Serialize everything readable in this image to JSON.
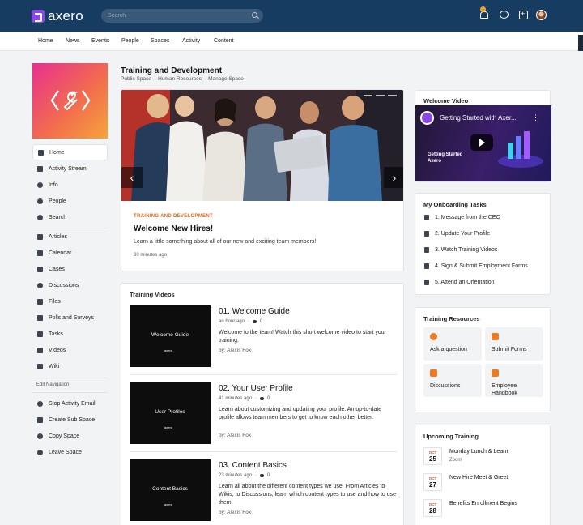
{
  "brand": {
    "name": "axero"
  },
  "search": {
    "placeholder": "Search"
  },
  "notifications": {
    "count": "1"
  },
  "nav": [
    "Home",
    "News",
    "Events",
    "People",
    "Spaces",
    "Activity",
    "Content"
  ],
  "sidebar": {
    "items": [
      {
        "label": "Home",
        "icon": "home-icon"
      },
      {
        "label": "Activity Stream",
        "icon": "list-icon"
      },
      {
        "label": "Info",
        "icon": "info-icon"
      },
      {
        "label": "People",
        "icon": "people-icon"
      },
      {
        "label": "Search",
        "icon": "search-icon"
      },
      {
        "label": "Articles",
        "icon": "article-icon"
      },
      {
        "label": "Calendar",
        "icon": "calendar-icon"
      },
      {
        "label": "Cases",
        "icon": "briefcase-icon"
      },
      {
        "label": "Discussions",
        "icon": "discussion-icon"
      },
      {
        "label": "Files",
        "icon": "folder-icon"
      },
      {
        "label": "Polls and Surveys",
        "icon": "poll-icon"
      },
      {
        "label": "Tasks",
        "icon": "checkbox-icon"
      },
      {
        "label": "Videos",
        "icon": "video-icon"
      },
      {
        "label": "Wiki",
        "icon": "book-icon"
      }
    ],
    "edit_heading": "Edit Navigation",
    "actions": [
      {
        "label": "Stop Activity Email",
        "icon": "stop-icon"
      },
      {
        "label": "Create Sub Space",
        "icon": "sitemap-icon"
      },
      {
        "label": "Copy Space",
        "icon": "gears-icon"
      },
      {
        "label": "Leave Space",
        "icon": "leave-icon"
      }
    ]
  },
  "space": {
    "title": "Training and Development",
    "crumbs": [
      "Public Space",
      "Human Resources",
      "Manage Space"
    ]
  },
  "featured": {
    "eyebrow": "TRAINING AND DEVELOPMENT",
    "title": "Welcome New Hires!",
    "description": "Learn a little something about all of our new and exciting team members!",
    "time": "30 minutes ago"
  },
  "training_videos": {
    "heading": "Training Videos",
    "items": [
      {
        "thumb": "Welcome Guide",
        "title": "01. Welcome Guide",
        "time": "an hour ago",
        "comments": "0",
        "description": "Welcome to the team! Watch this short welcome video to start your training.",
        "by": "by: Alexis Fox"
      },
      {
        "thumb": "User Profiles",
        "title": "02. Your User Profile",
        "time": "41 minutes ago",
        "comments": "0",
        "description": "Learn about customizing and updating your profile. An up-to-date profile allows team members to get to know each other better.",
        "by": "by: Alexis Fox"
      },
      {
        "thumb": "Content Basics",
        "title": "03. Content Basics",
        "time": "23 minutes ago",
        "comments": "0",
        "description": "Learn all about the different content types we use. From Articles to Wikis, to Discussions, learn which content types to use and how to use them.",
        "by": "by: Alexis Fox"
      }
    ],
    "thumb_brand": "axero"
  },
  "welcome_video": {
    "heading": "Welcome Video",
    "title": "Getting Started with Axer...",
    "subtitle_line1": "Getting Started",
    "subtitle_line2": "Axero"
  },
  "onboarding": {
    "heading": "My Onboarding Tasks",
    "tasks": [
      "1. Message from the CEO",
      "2. Update Your Profile",
      "3. Watch Training Videos",
      "4. Sign & Submit Employment Forms",
      "5. Attend an Orientation"
    ]
  },
  "resources": {
    "heading": "Training Resources",
    "items": [
      {
        "line1": "Ask a question",
        "line2": "",
        "icon": "question-icon"
      },
      {
        "line1": "Submit Forms",
        "line2": "",
        "icon": "briefcase-icon"
      },
      {
        "line1": "Discussions",
        "line2": "",
        "icon": "discussion-icon"
      },
      {
        "line1": "Employee",
        "line2": "Handbook",
        "icon": "book-icon"
      }
    ],
    "accent": "#ee7a22"
  },
  "upcoming": {
    "heading": "Upcoming Training",
    "events": [
      {
        "month": "OCT",
        "day": "25",
        "title": "Monday Lunch & Learn!",
        "location": "Zoom"
      },
      {
        "month": "OCT",
        "day": "27",
        "title": "New Hire Meet & Greet",
        "location": ""
      },
      {
        "month": "OCT",
        "day": "28",
        "title": "Benefits Enrollment Begins",
        "location": ""
      }
    ]
  },
  "colors": {
    "topbar": "#173c61",
    "brand": "#8b46e6",
    "accent": "#e2671a"
  }
}
